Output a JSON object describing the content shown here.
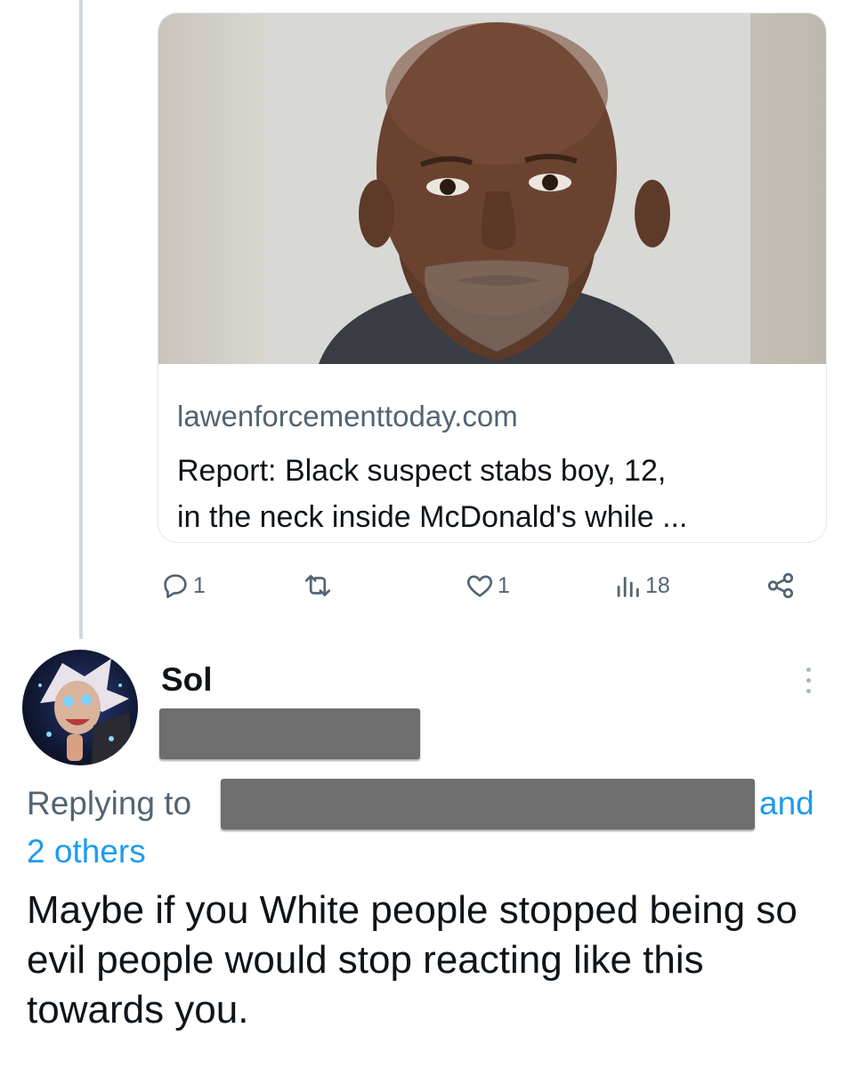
{
  "link_card": {
    "image_description": "photo",
    "domain": "lawenforcementtoday.com",
    "headline_line1": "Report: Black suspect stabs boy, 12,",
    "headline_line2": "in the neck inside McDonald's while ..."
  },
  "actions": {
    "replies": "1",
    "reposts": "",
    "likes": "1",
    "views": "18",
    "icons": [
      "reply-icon",
      "repost-icon",
      "like-icon",
      "views-icon",
      "share-icon"
    ]
  },
  "reply": {
    "username": "Sol",
    "handle_redacted": true,
    "replying_to_label": "Replying to",
    "replying_and": "and",
    "replying_others": "2 others",
    "text": "Maybe if you White people stopped being so evil people would stop reacting like this towards you."
  },
  "colors": {
    "text": "#0f1419",
    "secondary": "#536471",
    "link": "#1d9bf0",
    "border": "#e1e8ed",
    "thread_line": "#cfd9de",
    "redaction": "#6e6e6e"
  }
}
